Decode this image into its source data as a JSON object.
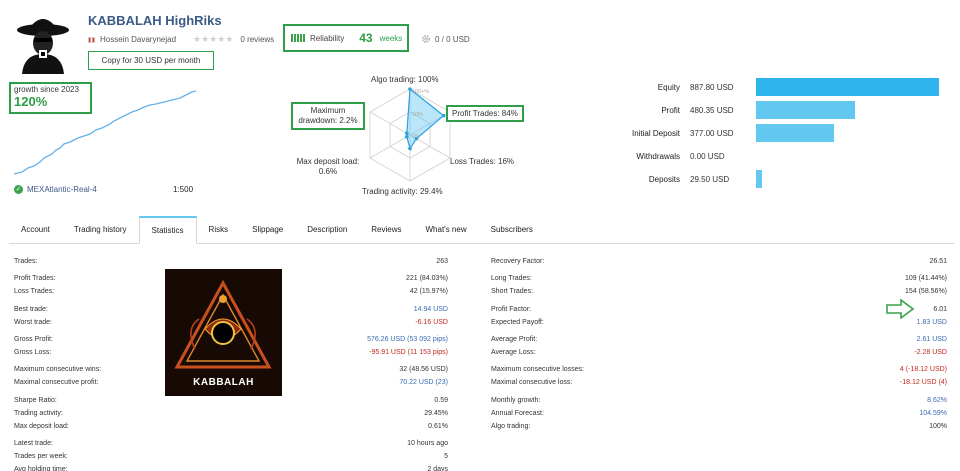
{
  "header": {
    "title": "KABBALAH HighRiks",
    "author": "Hossein Davarynejad",
    "reviews": "0 reviews",
    "copy_button": "Copy for 30 USD per month",
    "reliability_label": "Reliability",
    "weeks_value": "43",
    "weeks_unit": "weeks",
    "usd_text": "0 / 0 USD"
  },
  "growth": {
    "label": "growth since 2023",
    "value": "120%",
    "broker": "MEXAtlantic-Real-4",
    "leverage": "1:500"
  },
  "radar": {
    "algo": "Algo trading: 100%",
    "drawdown": "Maximum drawdown: 2.2%",
    "profit_trades": "Profit Trades: 84%",
    "deposit_load": "Max deposit load: 0.6%",
    "loss_trades": "Loss Trades: 16%",
    "activity": "Trading activity: 29.4%",
    "ring_100": "100+%",
    "ring_50": "50%",
    "ring_0": "0%",
    "values": {
      "algo": 1.0,
      "profit": 0.84,
      "loss": 0.16,
      "activity": 0.294,
      "deposit": 0.006,
      "drawdown": 0.022
    }
  },
  "financials": [
    {
      "label": "Equity",
      "value": "887.80 USD",
      "amount": 887.8
    },
    {
      "label": "Profit",
      "value": "480.35 USD",
      "amount": 480.35
    },
    {
      "label": "Initial Deposit",
      "value": "377.00 USD",
      "amount": 377.0
    },
    {
      "label": "Withdrawals",
      "value": "0.00 USD",
      "amount": 0
    },
    {
      "label": "Deposits",
      "value": "29.50 USD",
      "amount": 29.5
    }
  ],
  "tabs": [
    "Account",
    "Trading history",
    "Statistics",
    "Risks",
    "Slippage",
    "Description",
    "Reviews",
    "What's new",
    "Subscribers"
  ],
  "active_tab": "Statistics",
  "image_caption": "KABBALAH",
  "stats_left": [
    {
      "label": "Trades:",
      "value": "263"
    },
    {
      "label": "Profit Trades:",
      "value": "221 (84.03%)"
    },
    {
      "label": "Loss Trades:",
      "value": "42 (15.97%)"
    },
    {
      "label": "Best trade:",
      "value": "14.94 USD",
      "color": "blue"
    },
    {
      "label": "Worst trade:",
      "value": "-6.16 USD",
      "color": "red"
    },
    {
      "label": "Gross Profit:",
      "value": "576.26 USD (53 092 pips)",
      "color": "blue"
    },
    {
      "label": "Gross Loss:",
      "value": "-95.91 USD (11 153 pips)",
      "color": "red"
    },
    {
      "label": "Maximum consecutive wins:",
      "value": "32 (48.56 USD)"
    },
    {
      "label": "Maximal consecutive profit:",
      "value": "70.22 USD (23)",
      "color": "blue"
    },
    {
      "label": "Sharpe Ratio:",
      "value": "0.59"
    },
    {
      "label": "Trading activity:",
      "value": "29.45%"
    },
    {
      "label": "Max deposit load:",
      "value": "0.61%"
    },
    {
      "label": "Latest trade:",
      "value": "10 hours ago"
    },
    {
      "label": "Trades per week:",
      "value": "5"
    },
    {
      "label": "Avg holding time:",
      "value": "2 days"
    }
  ],
  "stats_right": [
    {
      "label": "Recovery Factor:",
      "value": "26.51"
    },
    {
      "label": "Long Trades:",
      "value": "109 (41.44%)"
    },
    {
      "label": "Short Trades:",
      "value": "154 (58.56%)"
    },
    {
      "label": "Profit Factor:",
      "value": "6.01"
    },
    {
      "label": "Expected Payoff:",
      "value": "1.83 USD",
      "color": "blue"
    },
    {
      "label": "Average Profit:",
      "value": "2.61 USD",
      "color": "blue"
    },
    {
      "label": "Average Loss:",
      "value": "-2.28 USD",
      "color": "red"
    },
    {
      "label": "Maximum consecutive losses:",
      "value": "4 (-18.12 USD)",
      "color": "red"
    },
    {
      "label": "Maximal consecutive loss:",
      "value": "-18.12 USD (4)",
      "color": "red"
    },
    {
      "label": "Monthly growth:",
      "value": "8.62%",
      "color": "blue"
    },
    {
      "label": "Annual Forecast:",
      "value": "104.59%",
      "color": "blue"
    },
    {
      "label": "Algo trading:",
      "value": "100%"
    }
  ],
  "colors": {
    "accent_green": "#2e9e48",
    "bar_blue": "#63c8ef",
    "link_blue": "#3c5a86",
    "loss_red": "#c0281c"
  }
}
